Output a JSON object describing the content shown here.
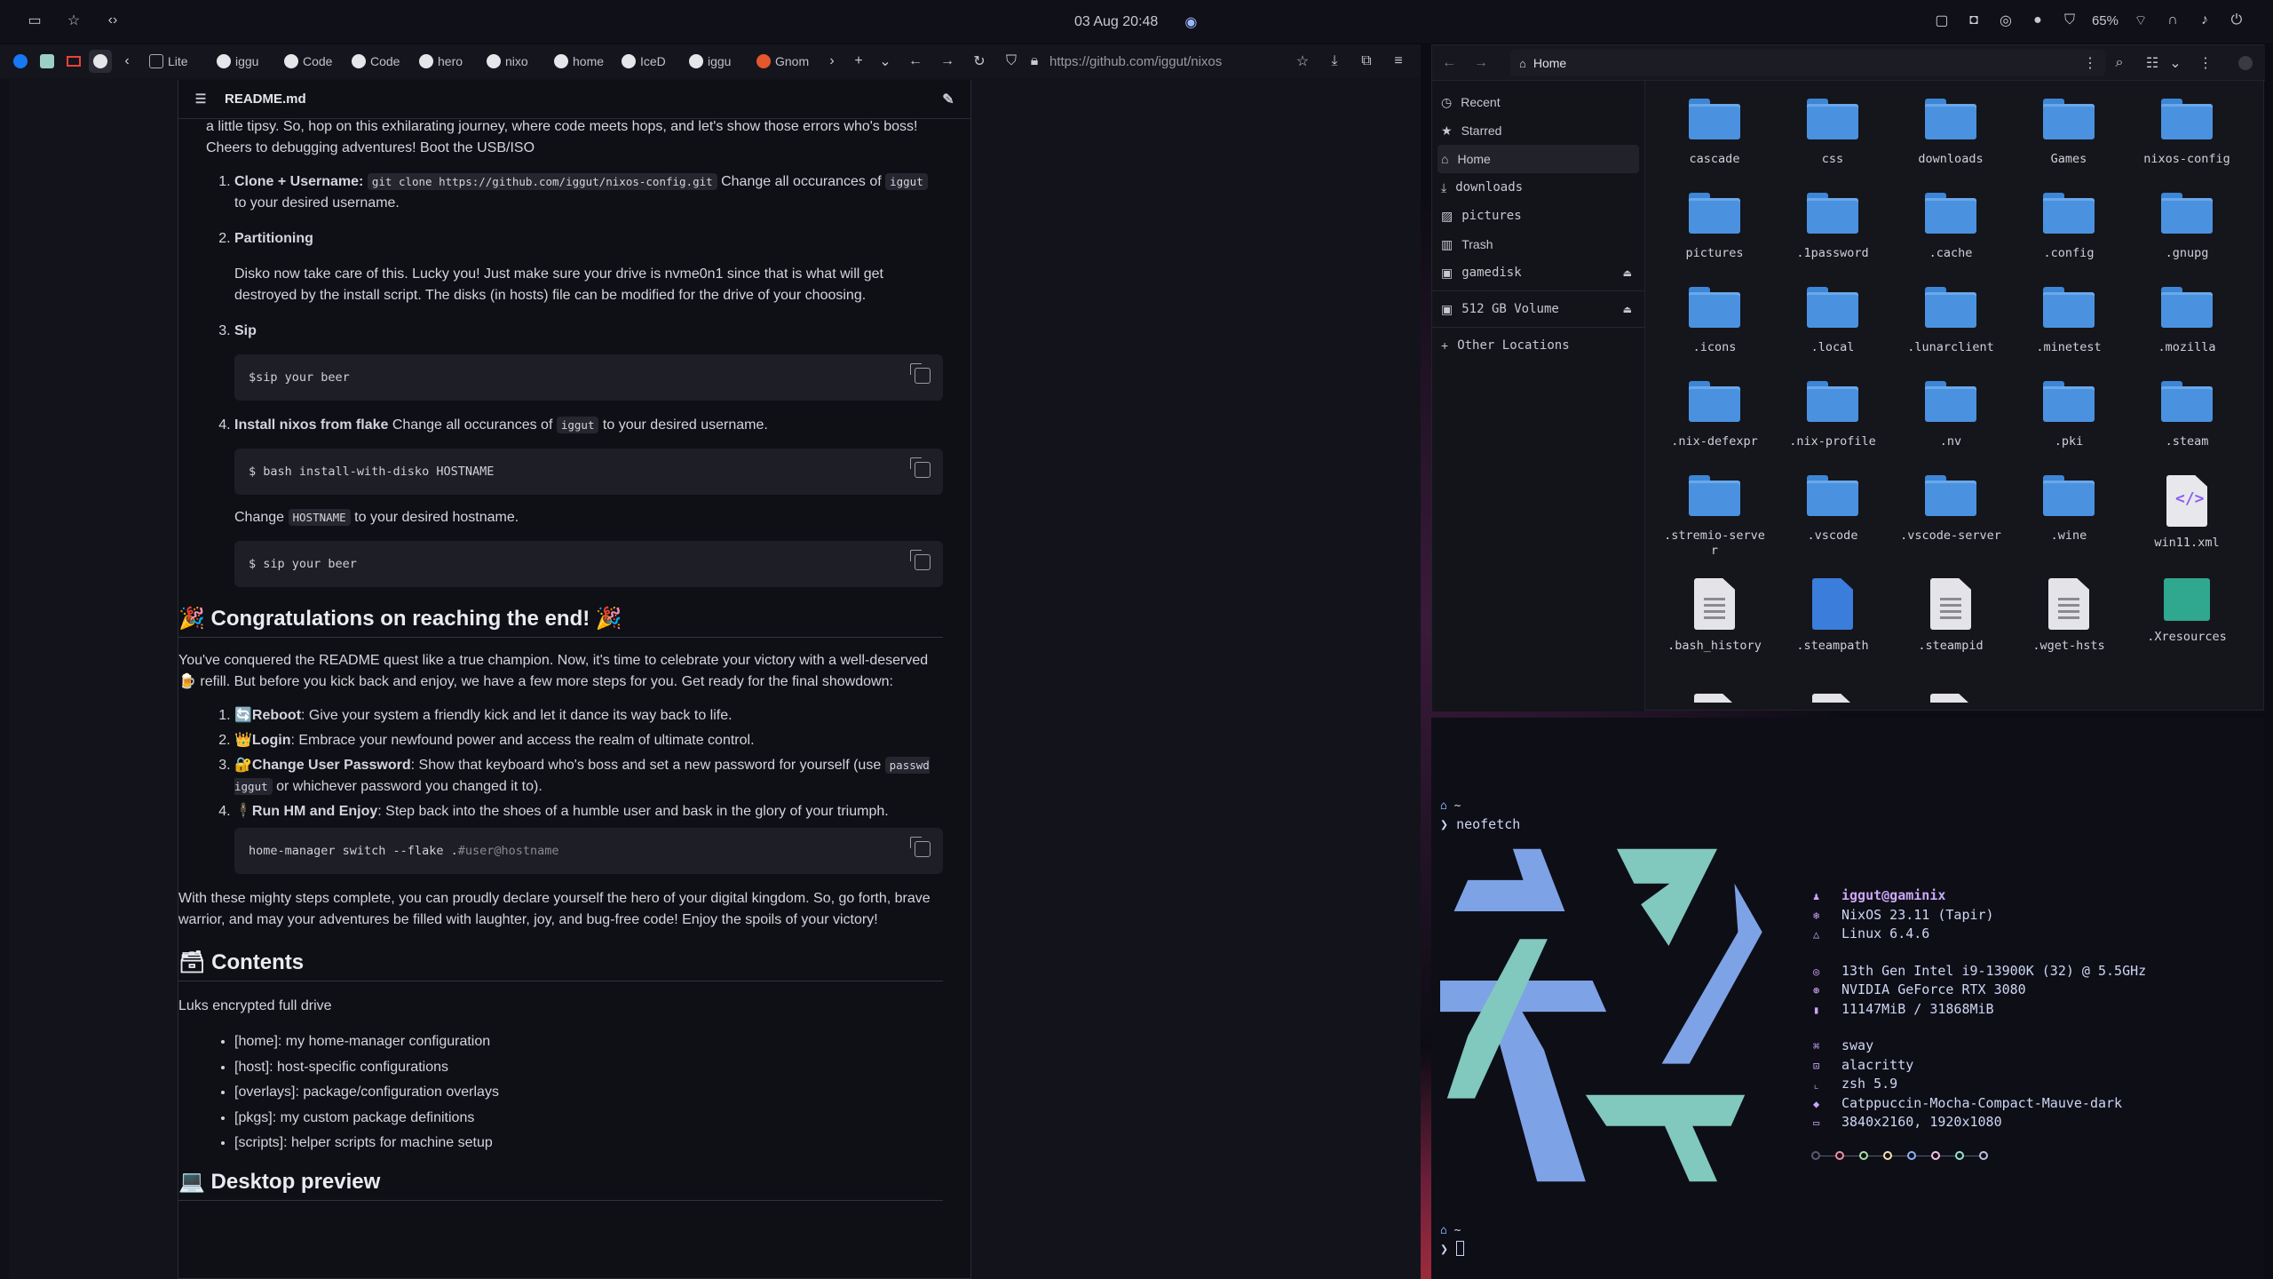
{
  "topbar": {
    "datetime": "03 Aug 20:48",
    "battery": "65%"
  },
  "browser": {
    "tabs": [
      "Lite",
      "iggu",
      "Code",
      "Code",
      "hero",
      "nixo",
      "home",
      "IceD",
      "iggu",
      "Gnom"
    ],
    "url": "https://github.com/iggut/nixos",
    "readme_title": "README.md",
    "content": {
      "intro": "a little tipsy. So, hop on this exhilarating journey, where code meets hops, and let's show those errors who's boss! Cheers to debugging adventures! Boot the USB/ISO",
      "s1_title": "Clone + Username:",
      "s1_code": "git clone https://github.com/iggut/nixos-config.git",
      "s1_text": " Change all occurances of ",
      "s1_code2": "iggut",
      "s1_text2": " to your desired username.",
      "s2_title": "Partitioning",
      "s2_text": "Disko now take care of this. Lucky you! Just make sure your drive is nvme0n1 since that is what will get destroyed by the install script. The disks (in hosts) file can be modified for the drive of your choosing.",
      "s3_title": "Sip",
      "s3_code": "$sip your beer",
      "s4_title": "Install nixos from flake",
      "s4_text": " Change all occurances of ",
      "s4_code": "iggut",
      "s4_text2": " to your desired username.",
      "s4_block": "$ bash install-with-disko HOSTNAME",
      "change_pre": "Change ",
      "change_code": "HOSTNAME",
      "change_post": " to your desired hostname.",
      "sip_block": "$ sip your beer",
      "h_congrats": "🎉 Congratulations on reaching the end! 🎉",
      "congrats_p": "You've conquered the README quest like a true champion. Now, it's time to celebrate your victory with a well-deserved 🍺 refill. But before you kick back and enjoy, we have a few more steps for you. Get ready for the final showdown:",
      "steps": [
        {
          "icon": "🔄",
          "title": "Reboot",
          "text": ": Give your system a friendly kick and let it dance its way back to life."
        },
        {
          "icon": "👑",
          "title": "Login",
          "text": ": Embrace your newfound power and access the realm of ultimate control."
        },
        {
          "icon": "🔐",
          "title": "Change User Password",
          "text": ": Show that keyboard who's boss and set a new password for yourself (use "
        },
        {
          "icon": "🕴",
          "title": "Run HM and Enjoy",
          "text": ": Step back into the shoes of a humble user and bask in the glory of your triumph."
        }
      ],
      "passwd_code": "passwd iggut",
      "passwd_tail": " or whichever password you changed it to).",
      "hm_code": "home-manager switch --flake .",
      "hm_code_dim": "#user@hostname",
      "final_p": "With these mighty steps complete, you can proudly declare yourself the hero of your digital kingdom. So, go forth, brave warrior, and may your adventures be filled with laughter, joy, and bug-free code! Enjoy the spoils of your victory!",
      "h_contents": "🗃 Contents",
      "luks": "Luks encrypted full drive",
      "contents": [
        "[home]: my home-manager configuration",
        "[host]: host-specific configurations",
        "[overlays]: package/configuration overlays",
        "[pkgs]: my custom package definitions",
        "[scripts]: helper scripts for machine setup"
      ],
      "h_desktop": "💻 Desktop preview"
    }
  },
  "files": {
    "location": "Home",
    "sidebar": [
      "Recent",
      "Starred",
      "Home",
      "downloads",
      "pictures",
      "Trash",
      "gamedisk",
      "512 GB Volume",
      "Other Locations"
    ],
    "items": [
      "cascade",
      "css",
      "downloads",
      "Games",
      "nixos-config",
      "pictures",
      ".1password",
      ".cache",
      ".config",
      ".gnupg",
      ".icons",
      ".local",
      ".lunarclient",
      ".minetest",
      ".mozilla",
      ".nix-defexpr",
      ".nix-profile",
      ".nv",
      ".pki",
      ".steam",
      ".stremio-server",
      ".vscode",
      ".vscode-server",
      ".wine",
      "win11.xml",
      ".bash_history",
      ".steampath",
      ".steampid",
      ".wget-hsts",
      ".Xresources"
    ]
  },
  "terminal": {
    "prompt_dir": "~",
    "command": "neofetch",
    "user_host": "iggut@gaminix",
    "os": "NixOS 23.11 (Tapir)",
    "kernel": "Linux 6.4.6",
    "cpu": "13th Gen Intel i9-13900K (32) @ 5.5GHz",
    "gpu": "NVIDIA GeForce RTX 3080",
    "memory": "11147MiB / 31868MiB",
    "wm": "sway",
    "terminal": "alacritty",
    "shell": "zsh 5.9",
    "theme": "Catppuccin-Mocha-Compact-Mauve-dark",
    "resolution": "3840x2160, 1920x1080",
    "palette": [
      "#585b70",
      "#f38ba8",
      "#a6e3a1",
      "#f9e2af",
      "#89b4fa",
      "#f5c2e7",
      "#94e2d5",
      "#bac2de"
    ],
    "prompt2_dir": "~"
  }
}
